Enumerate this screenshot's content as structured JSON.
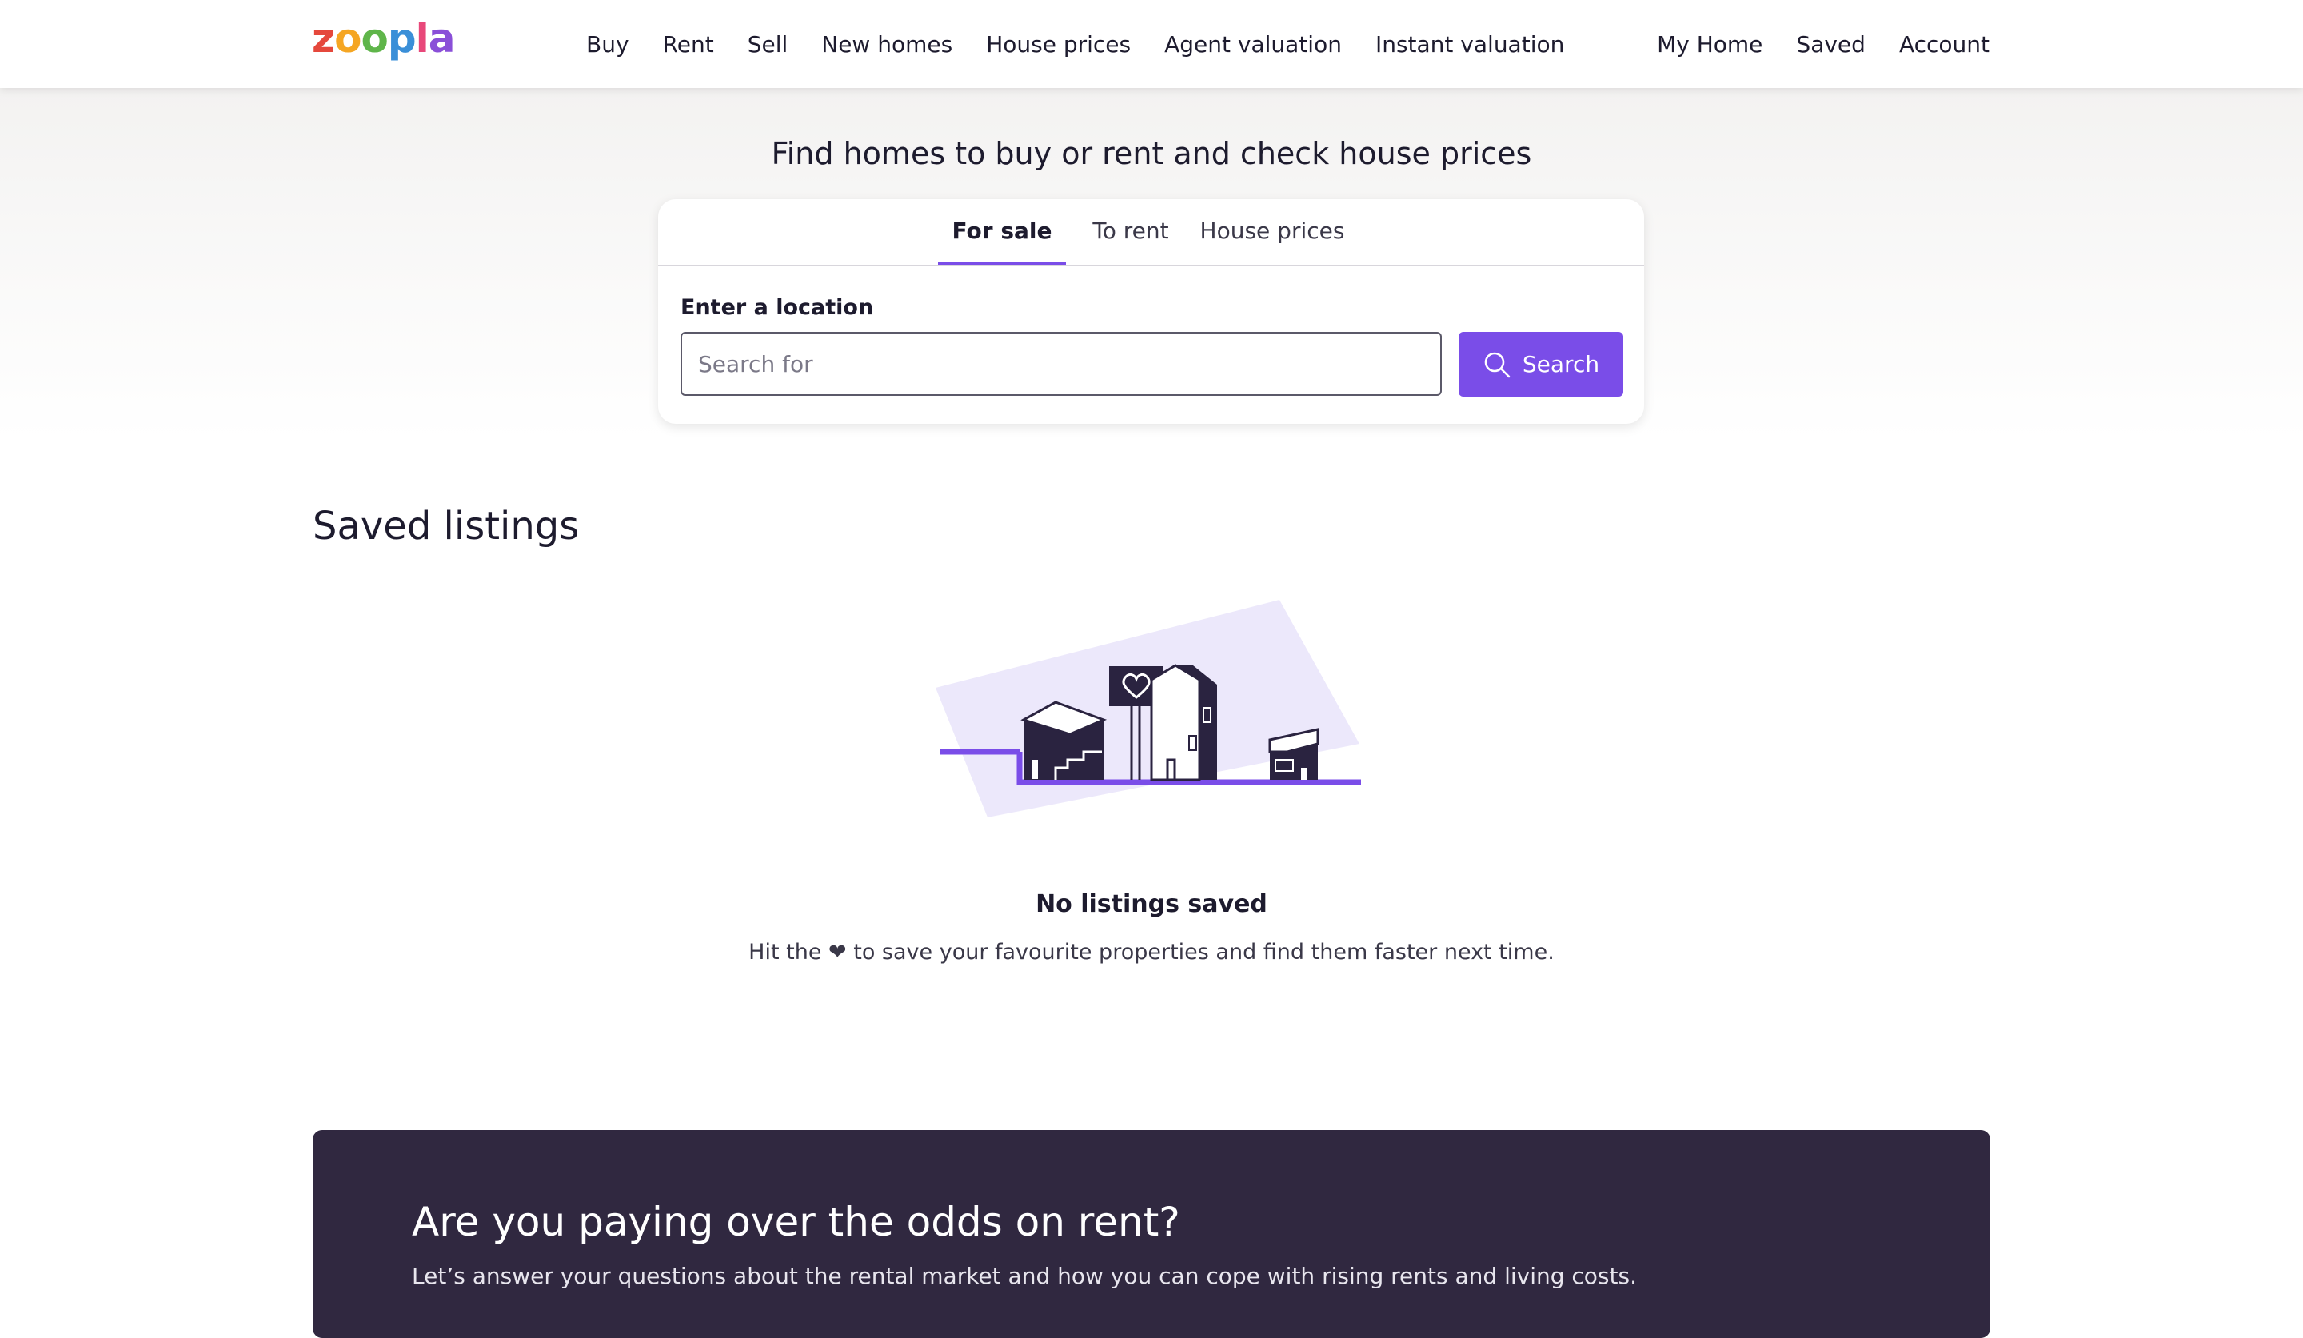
{
  "header": {
    "logo_text": "zoopla",
    "nav_main": [
      "Buy",
      "Rent",
      "Sell",
      "New homes",
      "House prices",
      "Agent valuation",
      "Instant valuation"
    ],
    "nav_right": [
      "My Home",
      "Saved",
      "Account"
    ]
  },
  "hero": {
    "title": "Find homes to buy or rent and check house prices",
    "tabs": [
      {
        "label": "For sale",
        "active": true
      },
      {
        "label": "To rent",
        "active": false
      },
      {
        "label": "House prices",
        "active": false
      }
    ],
    "location_label": "Enter a location",
    "location_placeholder": "Search for",
    "search_button": "Search"
  },
  "saved": {
    "title": "Saved listings",
    "empty_title": "No listings saved",
    "empty_text": "Hit the ❤ to save your favourite properties and find them faster next time."
  },
  "promo": {
    "title": "Are you paying over the odds on rent?",
    "text": "Let’s answer your questions about the rental market and how you can cope with rising rents and living costs."
  },
  "colors": {
    "accent": "#7a4de8",
    "dark": "#302840",
    "logo_letters": [
      "#e5483c",
      "#f5a623",
      "#5fb54a",
      "#3a8fd8",
      "#e8487a",
      "#8a4fd8"
    ]
  }
}
